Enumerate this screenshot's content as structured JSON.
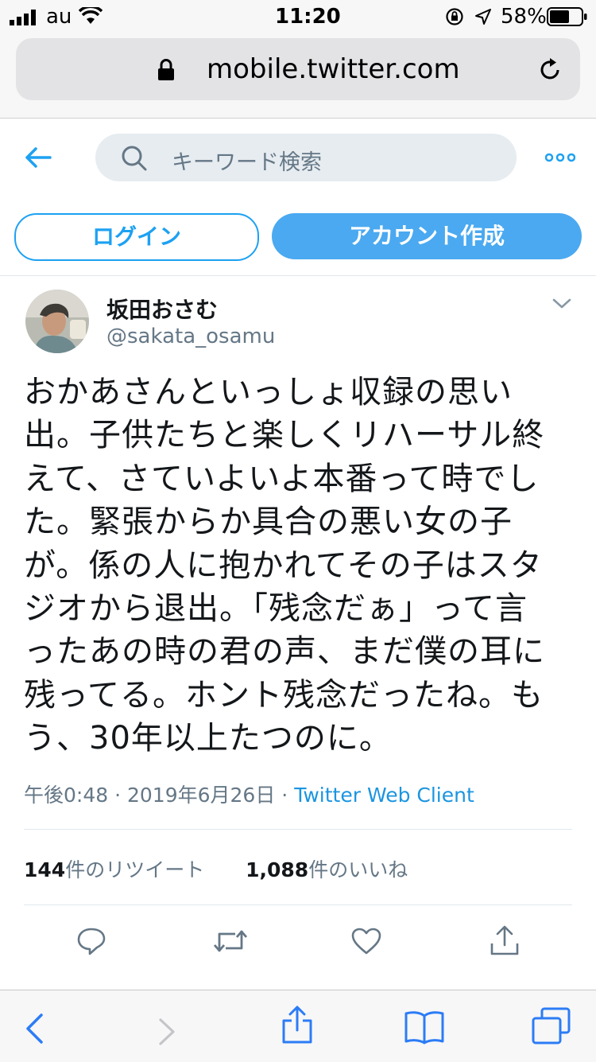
{
  "status_bar": {
    "carrier": "au",
    "time": "11:20",
    "battery": "58%"
  },
  "browser": {
    "url": "mobile.twitter.com"
  },
  "header": {
    "search_placeholder": "キーワード検索"
  },
  "auth": {
    "login_label": "ログイン",
    "signup_label": "アカウント作成"
  },
  "tweet": {
    "name": "坂田おさむ",
    "handle": "@sakata_osamu",
    "lines": [
      "おかあさんといっしょ収録の思い",
      "出。子供たちと楽しくリハーサル終",
      "えて、さていよいよ本番って時でし",
      "た。緊張からか具合の悪い女の子",
      "が。係の人に抱かれてその子はスタ",
      "ジオから退出。「残念だぁ」って言",
      "ったあの時の君の声、まだ僕の耳に",
      "残ってる。ホント残念だったね。も",
      "う、30年以上たつのに。"
    ],
    "time": "午後0:48",
    "date": "2019年6月26日",
    "separator": "·",
    "client": "Twitter Web Client",
    "retweet_count": "144",
    "retweet_label": "件のリツイート",
    "like_count": "1,088",
    "like_label": "件のいいね"
  },
  "icons": {
    "signal": "signal-bars-icon",
    "wifi": "wifi-icon",
    "rotation_lock": "rotation-lock-icon",
    "location": "location-arrow-icon",
    "battery": "battery-icon",
    "lock": "lock-icon",
    "reload": "reload-icon",
    "back": "back-arrow-icon",
    "search": "search-icon",
    "more": "more-dots-icon",
    "caret": "chevron-down-icon",
    "reply": "reply-icon",
    "retweet": "retweet-icon",
    "like": "heart-icon",
    "share": "share-icon",
    "safari_back": "chevron-left-icon",
    "safari_forward": "chevron-right-icon",
    "safari_share": "share-icon",
    "bookmarks": "book-icon",
    "tabs": "tabs-icon"
  },
  "colors": {
    "accent": "#1da1f2",
    "signup_bg": "#4aa9f0",
    "muted": "#657786",
    "link": "#1b95e0",
    "safari_blue": "#2c7cf6"
  }
}
